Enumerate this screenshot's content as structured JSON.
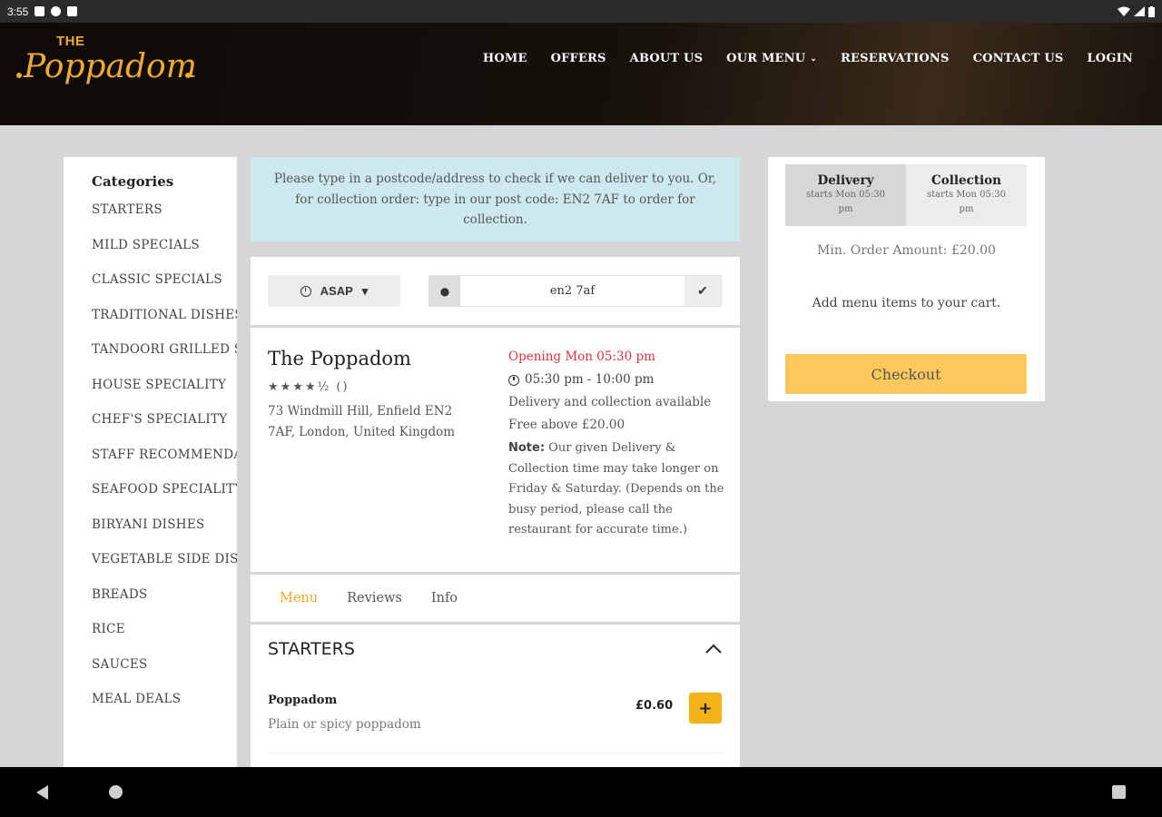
{
  "status_bar": {
    "time": "3:55"
  },
  "brand": {
    "logo_the": "THE",
    "logo_name": "Poppadom",
    "accent_color": "#f2a933"
  },
  "nav": {
    "home": "HOME",
    "offers": "OFFERS",
    "about": "ABOUT US",
    "menu": "OUR MENU",
    "reservations": "RESERVATIONS",
    "contact": "CONTACT US",
    "login": "LOGIN"
  },
  "categories": {
    "title": "Categories",
    "items": [
      "STARTERS",
      "MILD SPECIALS",
      "CLASSIC SPECIALS",
      "TRADITIONAL DISHES",
      "TANDOORI GRILLED SPE",
      "HOUSE SPECIALITY",
      "CHEF'S SPECIALITY",
      "STAFF RECOMMENDATI",
      "SEAFOOD SPECIALITY",
      "BIRYANI DISHES",
      "VEGETABLE SIDE DISHE",
      "BREADS",
      "RICE",
      "SAUCES",
      "MEAL DEALS"
    ]
  },
  "notice": {
    "text": "Please type in a postcode/address to check if we can deliver to you. Or, for collection order: type in our post code: EN2 7AF to order for collection."
  },
  "order": {
    "time_label": "ASAP",
    "postcode_value": "en2 7af"
  },
  "restaurant": {
    "name": "The Poppadom",
    "rating_text": "★★★★½ ()",
    "address": "73 Windmill Hill, Enfield EN2 7AF, London, United Kingdom",
    "opening": "Opening Mon 05:30 pm",
    "hours": "05:30 pm - 10:00 pm",
    "availability": "Delivery and collection available",
    "free_above": "Free above £20.00",
    "note_label": "Note:",
    "note_text": " Our given Delivery & Collection time may take longer on Friday & Saturday. (Depends on the busy period, please call the restaurant for accurate time.)"
  },
  "tabs": {
    "menu": "Menu",
    "reviews": "Reviews",
    "info": "Info"
  },
  "menu_section": {
    "title": "STARTERS",
    "items": [
      {
        "name": "Poppadom",
        "description": "Plain or spicy poppadom",
        "price": "£0.60",
        "add_label": "+"
      }
    ]
  },
  "cart": {
    "delivery_label": "Delivery",
    "delivery_sub": "starts Mon 05:30 pm",
    "collection_label": "Collection",
    "collection_sub": "starts Mon 05:30 pm",
    "min_order": "Min. Order Amount: £20.00",
    "empty_text": "Add menu items to your cart.",
    "checkout_label": "Checkout",
    "checkout_color": "#ffc85c"
  }
}
